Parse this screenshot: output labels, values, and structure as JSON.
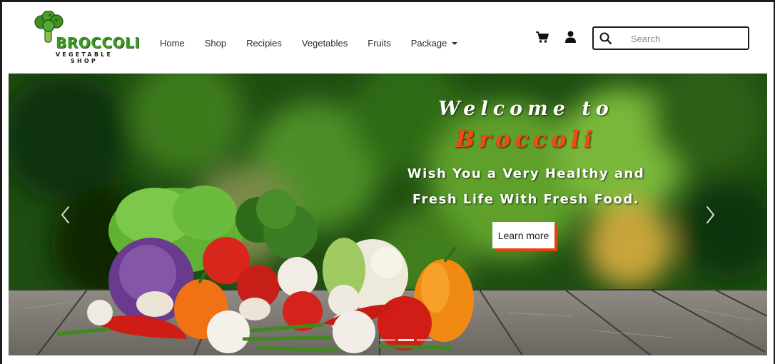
{
  "brand": {
    "name": "BROCCOLI",
    "tagline_line1": "VEGETABLE",
    "tagline_line2": "SHOP"
  },
  "nav": {
    "items": [
      {
        "label": "Home"
      },
      {
        "label": "Shop"
      },
      {
        "label": "Recipies"
      },
      {
        "label": "Vegetables"
      },
      {
        "label": "Fruits"
      },
      {
        "label": "Package",
        "has_dropdown": true
      }
    ]
  },
  "header": {
    "cart_icon": "shopping-cart-icon",
    "user_icon": "user-icon"
  },
  "search": {
    "placeholder": "Search",
    "value": "",
    "icon": "search-icon"
  },
  "hero": {
    "welcome": "Welcome to",
    "brand": "Broccoli",
    "tagline_line1": "Wish You a Very Healthy and",
    "tagline_line2": "Fresh Life With Fresh Food.",
    "button_label": "Learn more",
    "prev_icon": "chevron-left-icon",
    "next_icon": "chevron-right-icon",
    "slides_count": 3,
    "active_slide": 2
  },
  "colors": {
    "brand_green": "#3c9a21",
    "accent_orange": "#f44a12",
    "frame": "#1c1c1c"
  }
}
